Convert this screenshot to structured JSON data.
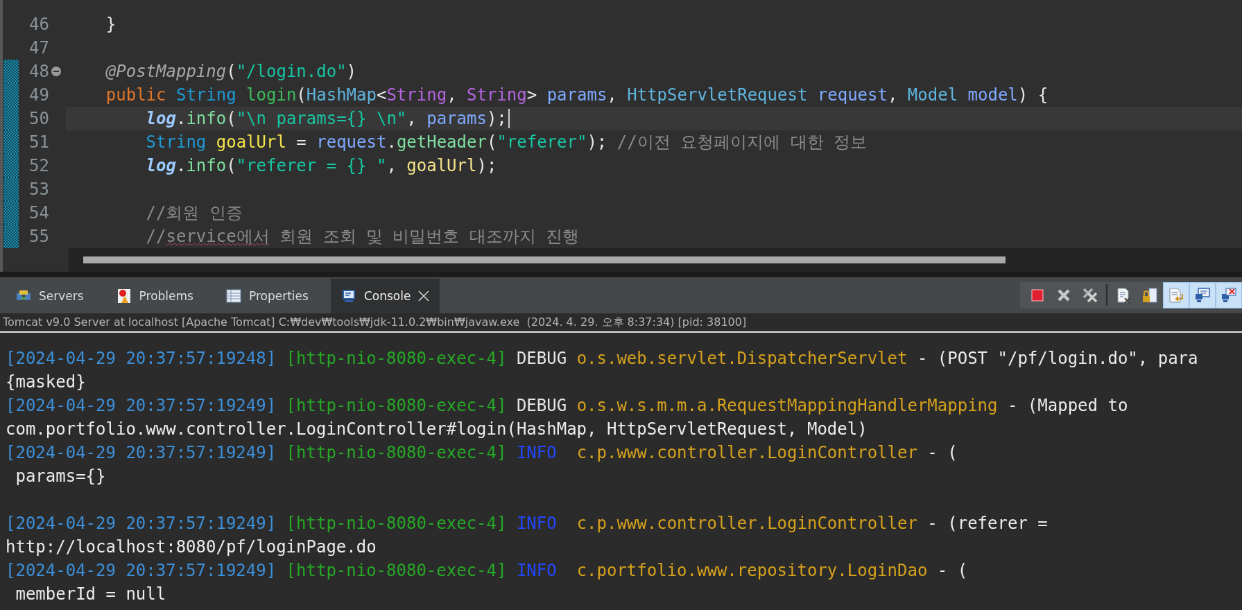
{
  "editor": {
    "lines": [
      {
        "number": "46",
        "changed": false,
        "folding": false,
        "current": false,
        "segments": [
          {
            "kind": "plain",
            "text": "    }"
          }
        ]
      },
      {
        "number": "47",
        "changed": false,
        "folding": false,
        "current": false
      },
      {
        "number": "48",
        "changed": true,
        "folding": true,
        "current": false,
        "segments": [
          {
            "kind": "annotation",
            "text": "    @PostMapping"
          },
          {
            "kind": "plain",
            "text": "("
          },
          {
            "kind": "string",
            "text": "\"/login.do\""
          },
          {
            "kind": "plain",
            "text": ")"
          }
        ]
      },
      {
        "number": "49",
        "changed": true,
        "folding": false,
        "current": false,
        "segments": [
          {
            "kind": "keyword",
            "text": "    public "
          },
          {
            "kind": "type",
            "text": "String "
          },
          {
            "kind": "method",
            "text": "login"
          },
          {
            "kind": "plain",
            "text": "("
          },
          {
            "kind": "class",
            "text": "HashMap"
          },
          {
            "kind": "plain",
            "text": "<"
          },
          {
            "kind": "generic",
            "text": "String"
          },
          {
            "kind": "plain",
            "text": ", "
          },
          {
            "kind": "generic",
            "text": "String"
          },
          {
            "kind": "plain",
            "text": "> "
          },
          {
            "kind": "param",
            "text": "params"
          },
          {
            "kind": "plain",
            "text": ", "
          },
          {
            "kind": "class",
            "text": "HttpServletRequest "
          },
          {
            "kind": "param",
            "text": "request"
          },
          {
            "kind": "plain",
            "text": ", "
          },
          {
            "kind": "class",
            "text": "Model "
          },
          {
            "kind": "param",
            "text": "model"
          },
          {
            "kind": "plain",
            "text": ") {"
          }
        ]
      },
      {
        "number": "50",
        "changed": true,
        "folding": false,
        "current": true,
        "segments": [
          {
            "kind": "field",
            "text": "        log"
          },
          {
            "kind": "plain",
            "text": "."
          },
          {
            "kind": "call",
            "text": "info"
          },
          {
            "kind": "plain",
            "text": "("
          },
          {
            "kind": "string",
            "text": "\"\\n params={} \\n\""
          },
          {
            "kind": "plain",
            "text": ", "
          },
          {
            "kind": "param",
            "text": "params"
          },
          {
            "kind": "plain",
            "text": ");"
          }
        ]
      },
      {
        "number": "51",
        "changed": true,
        "folding": false,
        "current": false,
        "segments": [
          {
            "kind": "type",
            "text": "        String "
          },
          {
            "kind": "local",
            "text": "goalUrl"
          },
          {
            "kind": "plain",
            "text": " = "
          },
          {
            "kind": "param",
            "text": "request"
          },
          {
            "kind": "plain",
            "text": "."
          },
          {
            "kind": "call",
            "text": "getHeader"
          },
          {
            "kind": "plain",
            "text": "("
          },
          {
            "kind": "string",
            "text": "\"referer\""
          },
          {
            "kind": "plain",
            "text": "); "
          },
          {
            "kind": "comment",
            "text": "//이전 요청페이지에 대한 정보"
          }
        ]
      },
      {
        "number": "52",
        "changed": true,
        "folding": false,
        "current": false,
        "segments": [
          {
            "kind": "field",
            "text": "        log"
          },
          {
            "kind": "plain",
            "text": "."
          },
          {
            "kind": "call",
            "text": "info"
          },
          {
            "kind": "plain",
            "text": "("
          },
          {
            "kind": "string",
            "text": "\"referer = {} \""
          },
          {
            "kind": "plain",
            "text": ", "
          },
          {
            "kind": "local_use",
            "text": "goalUrl"
          },
          {
            "kind": "plain",
            "text": ");"
          }
        ]
      },
      {
        "number": "53",
        "changed": true,
        "folding": false,
        "current": false
      },
      {
        "number": "54",
        "changed": true,
        "folding": false,
        "current": false,
        "segments": [
          {
            "kind": "comment",
            "text": "        //회원 인증"
          }
        ]
      },
      {
        "number": "55",
        "changed": true,
        "folding": false,
        "current": false,
        "segments": [
          {
            "kind": "comment",
            "text": "        //"
          },
          {
            "kind": "misspelled",
            "text": "service에서"
          },
          {
            "kind": "comment",
            "text": " 회원 조회 및 비밀번호 대조까지 진행"
          }
        ]
      }
    ]
  },
  "tabs": [
    {
      "label": "Servers",
      "selected": false,
      "closable": false
    },
    {
      "label": "Problems",
      "selected": false,
      "closable": false
    },
    {
      "label": "Properties",
      "selected": false,
      "closable": false
    },
    {
      "label": "Console",
      "selected": true,
      "closable": true
    }
  ],
  "toolbar": [
    {
      "kind": "stop",
      "pressed": false
    },
    {
      "kind": "remove",
      "pressed": false
    },
    {
      "kind": "remove_all",
      "pressed": false
    },
    {
      "kind": "separator"
    },
    {
      "kind": "clear",
      "pressed": false
    },
    {
      "kind": "scroll_lock",
      "pressed": false
    },
    {
      "kind": "pin",
      "pressed": true
    },
    {
      "kind": "display",
      "pressed": true
    },
    {
      "kind": "open",
      "pressed": true
    }
  ],
  "console": {
    "description": "Tomcat v9.0 Server at localhost [Apache Tomcat] C:₩dev₩tools₩jdk-11.0.2₩bin₩javaw.exe  (2024. 4. 29. 오후 8:37:34) [pid: 38100]",
    "lines": [
      {
        "kind": "text",
        "segments": [
          {
            "kind": "time",
            "text": "[2024-04-29 20:37:57:19248] "
          },
          {
            "kind": "thread",
            "text": "[http-nio-8080-exec-4] "
          },
          {
            "kind": "debug",
            "text": "DEBUG "
          },
          {
            "kind": "logger",
            "text": "o.s.web.servlet.DispatcherServlet"
          },
          {
            "kind": "message",
            "text": " - (POST \"/pf/login.do\", para"
          }
        ]
      },
      {
        "kind": "text",
        "segments": [
          {
            "kind": "message",
            "text": "{masked}"
          }
        ]
      },
      {
        "kind": "text",
        "segments": [
          {
            "kind": "time",
            "text": "[2024-04-29 20:37:57:19249] "
          },
          {
            "kind": "thread",
            "text": "[http-nio-8080-exec-4] "
          },
          {
            "kind": "debug",
            "text": "DEBUG "
          },
          {
            "kind": "logger",
            "text": "o.s.w.s.m.m.a.RequestMappingHandlerMapping"
          },
          {
            "kind": "message",
            "text": " - (Mapped to"
          }
        ]
      },
      {
        "kind": "text",
        "segments": [
          {
            "kind": "message",
            "text": "com.portfolio.www.controller.LoginController#login(HashMap, HttpServletRequest, Model)"
          }
        ]
      },
      {
        "kind": "text",
        "segments": [
          {
            "kind": "time",
            "text": "[2024-04-29 20:37:57:19249] "
          },
          {
            "kind": "thread",
            "text": "[http-nio-8080-exec-4] "
          },
          {
            "kind": "info",
            "text": "INFO  "
          },
          {
            "kind": "logger",
            "text": "c.p.www.controller.LoginController"
          },
          {
            "kind": "message",
            "text": " - ("
          }
        ]
      },
      {
        "kind": "text",
        "segments": [
          {
            "kind": "message",
            "text": " params={}"
          }
        ]
      },
      {
        "kind": "blank"
      },
      {
        "kind": "text",
        "segments": [
          {
            "kind": "time",
            "text": "[2024-04-29 20:37:57:19249] "
          },
          {
            "kind": "thread",
            "text": "[http-nio-8080-exec-4] "
          },
          {
            "kind": "info",
            "text": "INFO  "
          },
          {
            "kind": "logger",
            "text": "c.p.www.controller.LoginController"
          },
          {
            "kind": "message",
            "text": " - (referer ="
          }
        ]
      },
      {
        "kind": "text",
        "segments": [
          {
            "kind": "message",
            "text": "http://localhost:8080/pf/loginPage.do"
          }
        ]
      },
      {
        "kind": "text",
        "segments": [
          {
            "kind": "time",
            "text": "[2024-04-29 20:37:57:19249] "
          },
          {
            "kind": "thread",
            "text": "[http-nio-8080-exec-4] "
          },
          {
            "kind": "info",
            "text": "INFO  "
          },
          {
            "kind": "logger",
            "text": "c.portfolio.www.repository.LoginDao"
          },
          {
            "kind": "message",
            "text": " - ("
          }
        ]
      },
      {
        "kind": "text",
        "segments": [
          {
            "kind": "message",
            "text": " memberId = null"
          }
        ]
      }
    ]
  }
}
